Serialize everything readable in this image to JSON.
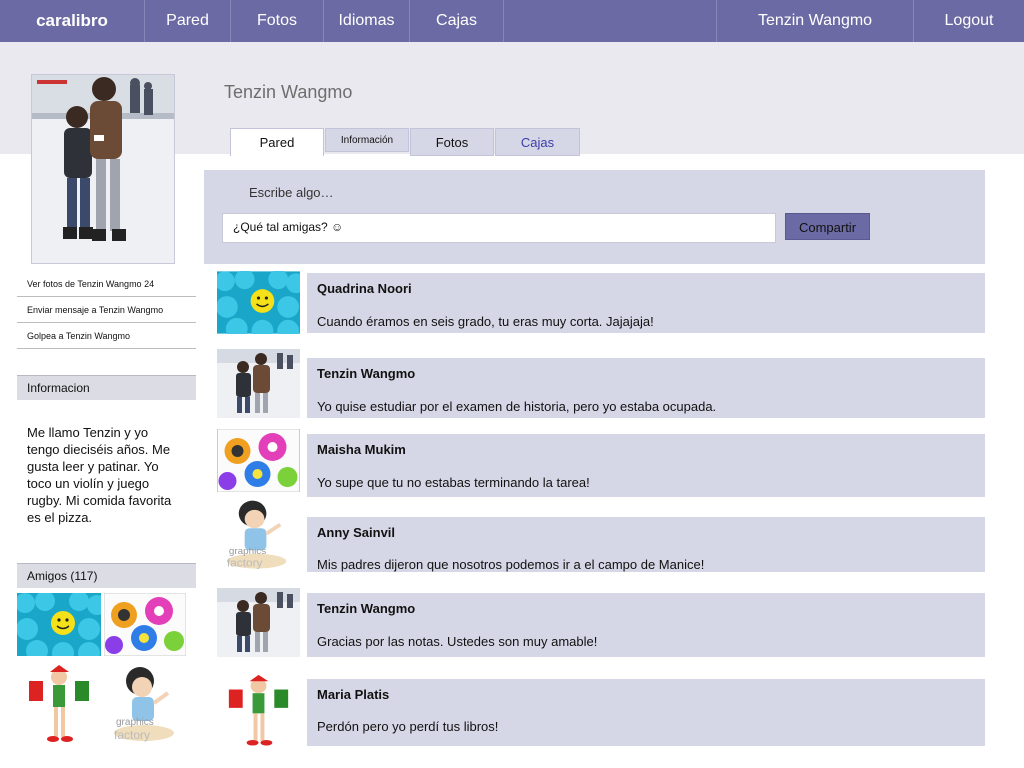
{
  "nav": {
    "brand": "caralibro",
    "items": [
      {
        "label": "Pared"
      },
      {
        "label": "Fotos"
      },
      {
        "label": "Idiomas"
      },
      {
        "label": "Cajas"
      }
    ],
    "user": "Tenzin Wangmo",
    "logout": "Logout"
  },
  "profile": {
    "name": "Tenzin Wangmo"
  },
  "tabs": [
    {
      "label": "Pared",
      "active": true
    },
    {
      "label": "Información"
    },
    {
      "label": "Fotos"
    },
    {
      "label": "Cajas"
    }
  ],
  "status": {
    "label": "Escribe algo…",
    "value": "¿Qué tal amigas? ☺",
    "share": "Compartir"
  },
  "sidebar": {
    "links": [
      {
        "label": "Ver fotos de Tenzin Wangmo 24"
      },
      {
        "label": "Enviar mensaje a Tenzin Wangmo"
      },
      {
        "label": "Golpea a Tenzin Wangmo"
      }
    ],
    "info_header": "Informacion",
    "bio": "Me llamo Tenzin y yo tengo dieciséis años. Me gusta leer y patinar. Yo toco un violín y juego rugby. Mi comida favorita es el pizza.",
    "friends_header": "Amigos  (117)"
  },
  "posts": [
    {
      "author": "Quadrina Noori",
      "text": "Cuando éramos en seis grado, tu eras muy corta. Jajajaja!"
    },
    {
      "author": "Tenzin Wangmo",
      "text": "Yo quise estudiar por el examen de historia, pero yo estaba ocupada."
    },
    {
      "author": "Maisha Mukim",
      "text": "Yo supe que tu no estabas terminando la tarea!"
    },
    {
      "author": "Anny Sainvil",
      "text": "Mis padres dijeron que nosotros podemos ir a el campo de Manice!"
    },
    {
      "author": "Tenzin Wangmo",
      "text": "Gracias por las notas. Ustedes son muy amable!"
    },
    {
      "author": "Maria Platis",
      "text": "Perdón pero yo perdí tus libros!"
    }
  ],
  "colors": {
    "nav": "#6b6aa4",
    "panel": "#d6d7e6",
    "band": "#e9e9ef"
  }
}
